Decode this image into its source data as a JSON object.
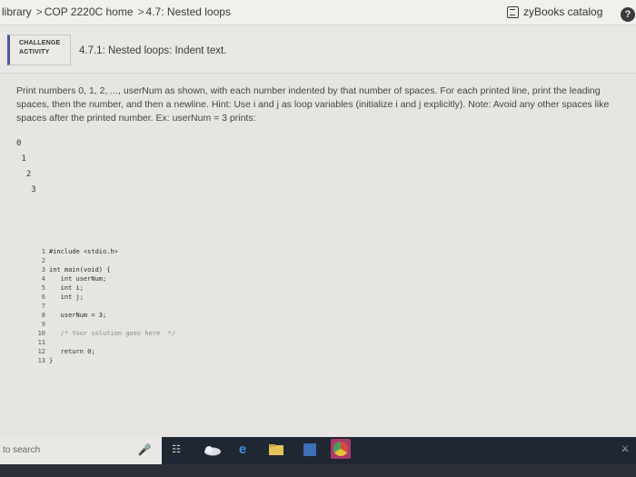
{
  "breadcrumb": {
    "items": [
      "library",
      "COP 2220C home",
      "4.7: Nested loops"
    ],
    "separator": ">"
  },
  "header": {
    "catalog_label": "zyBooks catalog",
    "help_label": "?"
  },
  "activity": {
    "badge_line1": "CHALLENGE",
    "badge_line2": "ACTIVITY",
    "title": "4.7.1: Nested loops: Indent text."
  },
  "instructions": {
    "text": "Print numbers 0, 1, 2, ..., userNum as shown, with each number indented by that number of spaces. For each printed line, print the leading spaces, then the number, and then a newline. Hint: Use i and j as loop variables (initialize i and j explicitly). Note: Avoid any other spaces like spaces after the printed number. Ex: userNum = 3 prints:"
  },
  "output_example": {
    "lines": [
      "0",
      " 1",
      "  2",
      "   3"
    ]
  },
  "code_editor": {
    "lines": [
      {
        "num": "1",
        "text": "#include <stdio.h>",
        "comment": false
      },
      {
        "num": "2",
        "text": "",
        "comment": false
      },
      {
        "num": "3",
        "text": "int main(void) {",
        "comment": false
      },
      {
        "num": "4",
        "text": "   int userNum;",
        "comment": false
      },
      {
        "num": "5",
        "text": "   int i;",
        "comment": false
      },
      {
        "num": "6",
        "text": "   int j;",
        "comment": false
      },
      {
        "num": "7",
        "text": "",
        "comment": false
      },
      {
        "num": "8",
        "text": "   userNum = 3;",
        "comment": false
      },
      {
        "num": "9",
        "text": "",
        "comment": false
      },
      {
        "num": "10",
        "text": "   /* Your solution goes here  */",
        "comment": true
      },
      {
        "num": "11",
        "text": "",
        "comment": false
      },
      {
        "num": "12",
        "text": "   return 0;",
        "comment": false
      },
      {
        "num": "13",
        "text": "}",
        "comment": false
      }
    ]
  },
  "taskbar": {
    "search_placeholder": "to search",
    "icons": [
      "mic-icon",
      "task-view-icon",
      "weather-icon",
      "edge-icon",
      "file-explorer-icon",
      "store-icon",
      "chrome-icon",
      "people-icon"
    ]
  }
}
